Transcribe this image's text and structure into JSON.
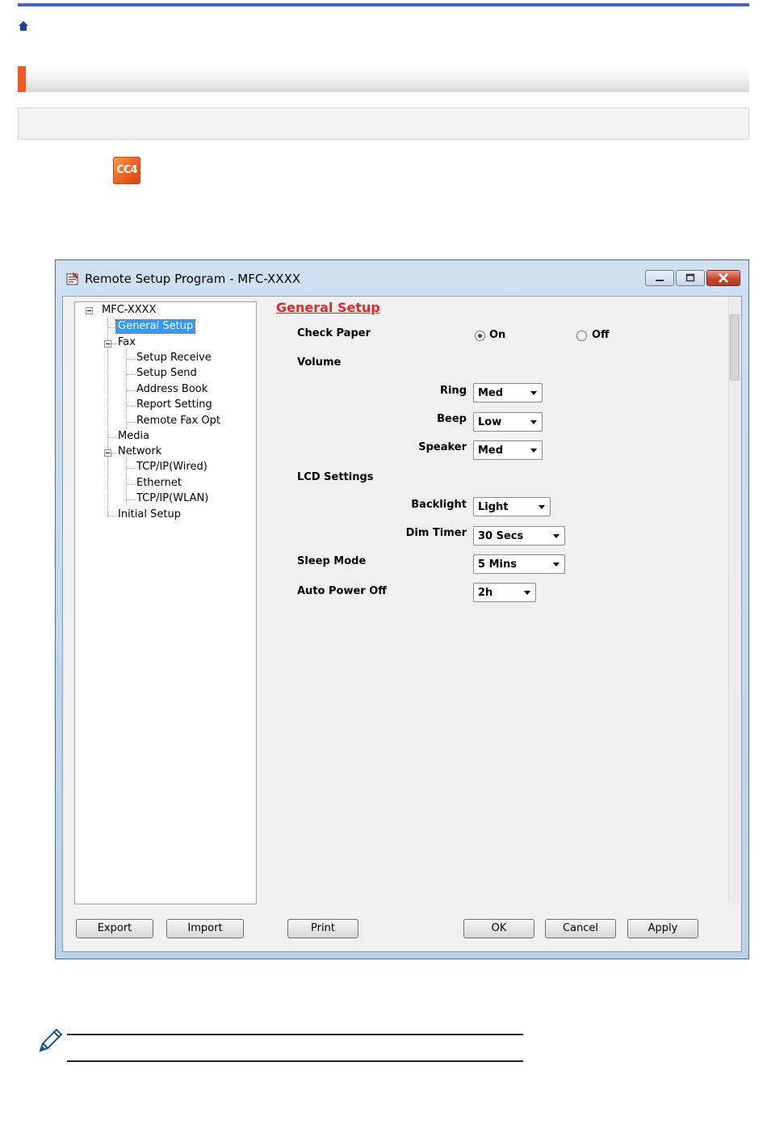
{
  "window": {
    "title": "Remote Setup Program - MFC-XXXX"
  },
  "tree": {
    "root": "MFC-XXXX",
    "items": [
      {
        "label": "General Setup",
        "selected": true
      },
      {
        "label": "Fax"
      },
      {
        "label": "Setup Receive"
      },
      {
        "label": "Setup Send"
      },
      {
        "label": "Address Book"
      },
      {
        "label": "Report Setting"
      },
      {
        "label": "Remote Fax Opt"
      },
      {
        "label": "Media"
      },
      {
        "label": "Network"
      },
      {
        "label": "TCP/IP(Wired)"
      },
      {
        "label": "Ethernet"
      },
      {
        "label": "TCP/IP(WLAN)"
      },
      {
        "label": "Initial Setup"
      }
    ]
  },
  "settings": {
    "title": "General Setup",
    "check_paper": {
      "label": "Check Paper",
      "on": "On",
      "off": "Off",
      "selected": "On"
    },
    "volume": {
      "label": "Volume",
      "ring": {
        "label": "Ring",
        "value": "Med"
      },
      "beep": {
        "label": "Beep",
        "value": "Low"
      },
      "speaker": {
        "label": "Speaker",
        "value": "Med"
      }
    },
    "lcd": {
      "label": "LCD Settings",
      "backlight": {
        "label": "Backlight",
        "value": "Light"
      },
      "dim_timer": {
        "label": "Dim Timer",
        "value": "30 Secs"
      }
    },
    "sleep_mode": {
      "label": "Sleep Mode",
      "value": "5 Mins"
    },
    "auto_power_off": {
      "label": "Auto Power Off",
      "value": "2h"
    }
  },
  "buttons": {
    "export": "Export",
    "import": "Import",
    "print": "Print",
    "ok": "OK",
    "cancel": "Cancel",
    "apply": "Apply"
  },
  "app_icon": {
    "text": "CC4"
  },
  "colors": {
    "top_rule": "#4a63c0",
    "section_accent": "#f05a22",
    "pane_title": "#e32a2a",
    "selection": "#3399ff"
  }
}
